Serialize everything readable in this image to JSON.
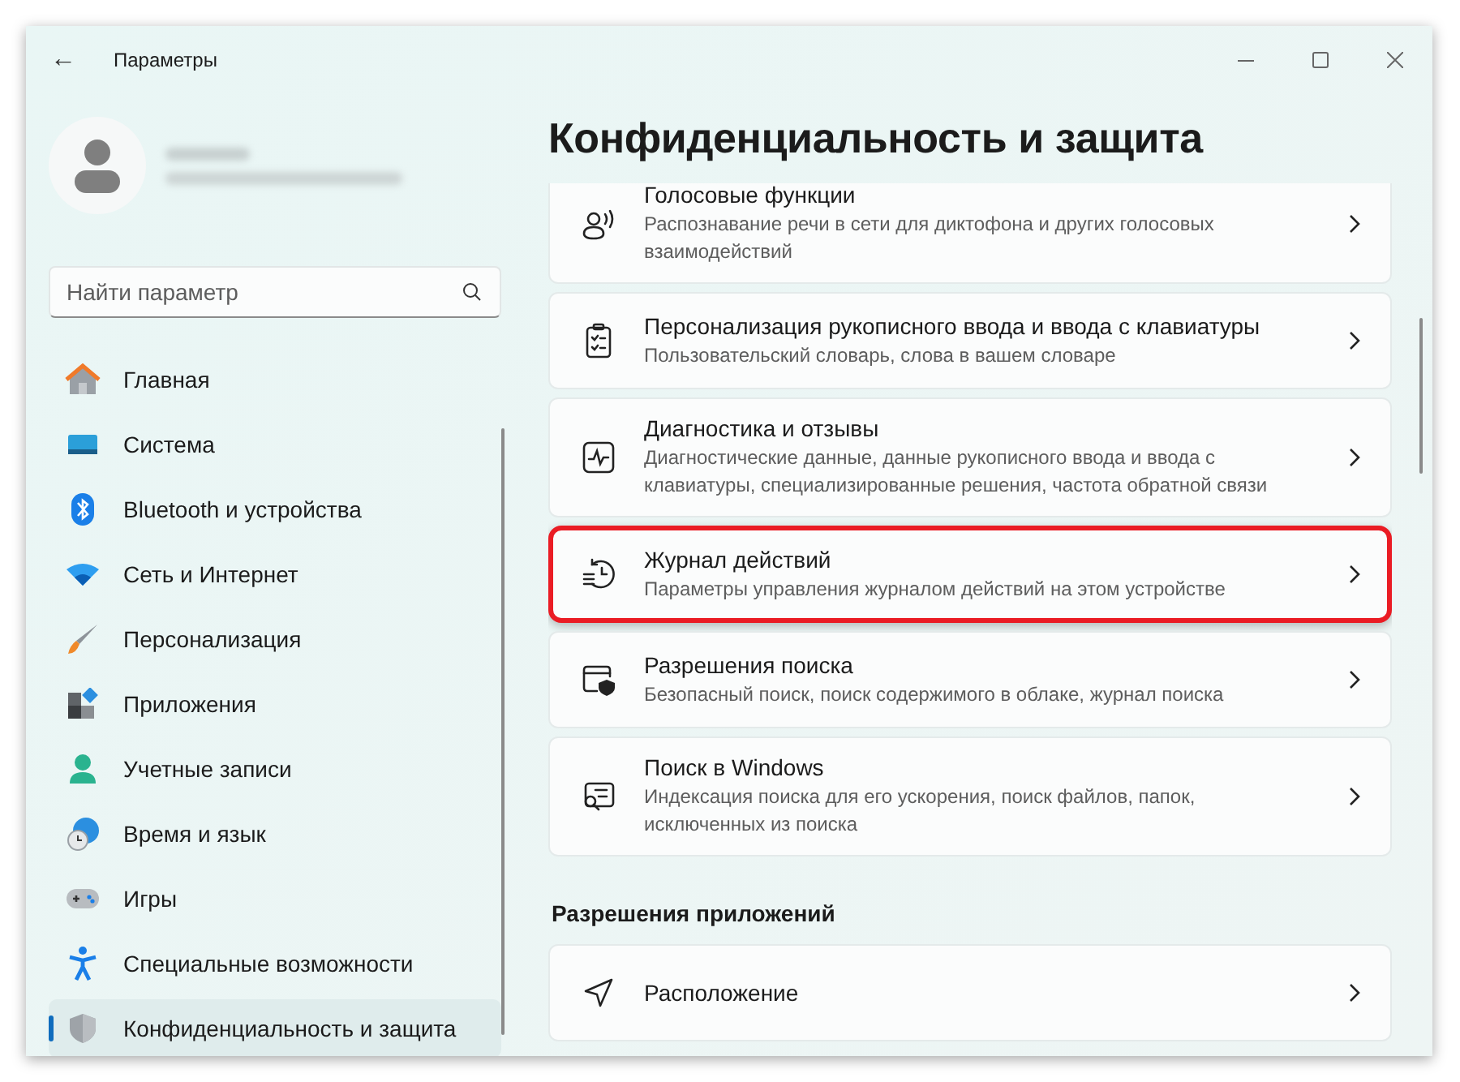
{
  "window": {
    "title": "Параметры",
    "back": "←"
  },
  "search": {
    "placeholder": "Найти параметр"
  },
  "sidebar": {
    "items": [
      {
        "label": "Главная",
        "selected": false
      },
      {
        "label": "Система",
        "selected": false
      },
      {
        "label": "Bluetooth и устройства",
        "selected": false
      },
      {
        "label": "Сеть и Интернет",
        "selected": false
      },
      {
        "label": "Персонализация",
        "selected": false
      },
      {
        "label": "Приложения",
        "selected": false
      },
      {
        "label": "Учетные записи",
        "selected": false
      },
      {
        "label": "Время и язык",
        "selected": false
      },
      {
        "label": "Игры",
        "selected": false
      },
      {
        "label": "Специальные возможности",
        "selected": false
      },
      {
        "label": "Конфиденциальность и защита",
        "selected": true
      }
    ]
  },
  "page": {
    "title": "Конфиденциальность и защита",
    "cards": [
      {
        "title": "Голосовые функции",
        "description": "Распознавание речи в сети для диктофона и других голосовых взаимодействий",
        "highlighted": false
      },
      {
        "title": "Персонализация рукописного ввода и ввода с клавиатуры",
        "description": "Пользовательский словарь, слова в вашем словаре",
        "highlighted": false
      },
      {
        "title": "Диагностика и отзывы",
        "description": "Диагностические данные, данные рукописного ввода и ввода с клавиатуры, специализированные решения, частота обратной связи",
        "highlighted": false
      },
      {
        "title": "Журнал действий",
        "description": "Параметры управления журналом действий на этом устройстве",
        "highlighted": true
      },
      {
        "title": "Разрешения поиска",
        "description": "Безопасный поиск, поиск содержимого в облаке, журнал поиска",
        "highlighted": false
      },
      {
        "title": "Поиск в Windows",
        "description": "Индексация поиска для его ускорения, поиск файлов, папок, исключенных из поиска",
        "highlighted": false
      }
    ],
    "section": {
      "title": "Разрешения приложений",
      "cards": [
        {
          "title": "Расположение",
          "highlighted": false
        }
      ]
    }
  }
}
